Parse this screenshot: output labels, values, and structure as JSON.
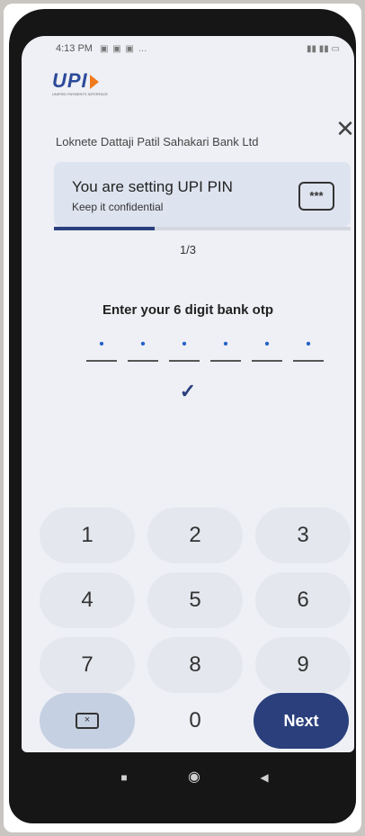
{
  "status_bar": {
    "time": "4:13 PM",
    "notification_icons": "▣ ▣ ▣ …",
    "system_icons": "▮▮ ▮▮ ▭"
  },
  "header": {
    "logo_text": "UPI",
    "logo_tagline": "UNIFIED PAYMENTS INTERFACE",
    "bank_name": "Loknete Dattaji Patil Sahakari Bank Ltd",
    "close_glyph": "✕"
  },
  "card": {
    "title": "You are setting UPI PIN",
    "subtitle": "Keep it confidential",
    "icon_text": "***"
  },
  "progress": {
    "fraction": 0.34,
    "step_label": "1/3"
  },
  "otp": {
    "prompt": "Enter your 6 digit bank otp",
    "digits": [
      "•",
      "•",
      "•",
      "•",
      "•",
      "•"
    ]
  },
  "confirm": {
    "check_glyph": "✓"
  },
  "keypad": {
    "k1": "1",
    "k2": "2",
    "k3": "3",
    "k4": "4",
    "k5": "5",
    "k6": "6",
    "k7": "7",
    "k8": "8",
    "k9": "9",
    "backspace": "×",
    "k0": "0",
    "next": "Next"
  },
  "navbar": {
    "recents": "■",
    "home": "◉",
    "back": "◀"
  },
  "colors": {
    "accent": "#2a3f7c",
    "otp_digit": "#2562c8",
    "screen_bg": "#eef0f5",
    "card_bg": "#dde3ef"
  }
}
